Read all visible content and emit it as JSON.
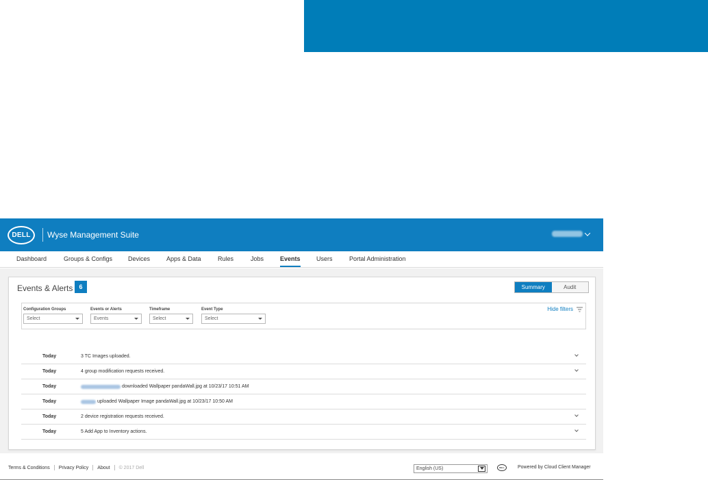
{
  "colors": {
    "brand_blue": "#0f7ec0",
    "banner_blue": "#007db8"
  },
  "header": {
    "logo_text": "DELL",
    "app_title": "Wyse Management Suite",
    "user_menu_icon": "chevron-down-icon"
  },
  "nav": {
    "items": [
      {
        "label": "Dashboard",
        "active": false
      },
      {
        "label": "Groups & Configs",
        "active": false
      },
      {
        "label": "Devices",
        "active": false
      },
      {
        "label": "Apps & Data",
        "active": false
      },
      {
        "label": "Rules",
        "active": false
      },
      {
        "label": "Jobs",
        "active": false
      },
      {
        "label": "Events",
        "active": true
      },
      {
        "label": "Users",
        "active": false
      },
      {
        "label": "Portal Administration",
        "active": false
      }
    ]
  },
  "panel": {
    "title": "Events & Alerts",
    "count": "6",
    "view_toggle": {
      "summary": "Summary",
      "audit": "Audit",
      "selected": "Summary"
    },
    "hide_filters": "Hide filters",
    "filters": [
      {
        "label": "Configuration Groups",
        "value": "Select"
      },
      {
        "label": "Events or Alerts",
        "value": "Events"
      },
      {
        "label": "Timeframe",
        "value": "Select"
      },
      {
        "label": "Event Type",
        "value": "Select"
      }
    ]
  },
  "events": [
    {
      "date": "Today",
      "message": "3 TC Images uploaded.",
      "expandable": true,
      "redacted_user": false
    },
    {
      "date": "Today",
      "message": "4 group modification requests received.",
      "expandable": true,
      "redacted_user": false
    },
    {
      "date": "Today",
      "message": "downloaded Wallpaper pandaWall.jpg at 10/23/17 10:51 AM",
      "expandable": false,
      "redacted_user": true
    },
    {
      "date": "Today",
      "message": "uploaded Wallpaper Image pandaWall.jpg at 10/23/17 10:50 AM",
      "expandable": false,
      "redacted_user": true
    },
    {
      "date": "Today",
      "message": "2 device registration requests received.",
      "expandable": true,
      "redacted_user": false
    },
    {
      "date": "Today",
      "message": "5 Add App to Inventory actions.",
      "expandable": true,
      "redacted_user": false
    }
  ],
  "footer": {
    "links": [
      "Terms & Conditions",
      "Privacy Policy",
      "About"
    ],
    "copyright": "© 2017 Dell",
    "language": "English (US)",
    "powered_by": "Powered by Cloud Client Manager"
  }
}
